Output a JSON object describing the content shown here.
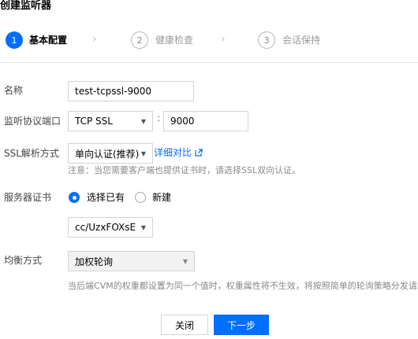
{
  "page": {
    "title": "创建监听器"
  },
  "steps": [
    {
      "number": "1",
      "label": "基本配置"
    },
    {
      "number": "2",
      "label": "健康检查"
    },
    {
      "number": "3",
      "label": "会话保持"
    }
  ],
  "form": {
    "name": {
      "label": "名称",
      "value": "test-tcpssl-9000"
    },
    "protocol_port": {
      "label": "监听协议端口",
      "protocol": "TCP SSL",
      "separator": ":",
      "port": "9000"
    },
    "ssl_mode": {
      "label": "SSL解析方式",
      "value": "单向认证(推荐)",
      "compare_link": "详细对比",
      "hint": "注意：当您需要客户端也提供证书时，请选择SSL双向认证。"
    },
    "server_cert": {
      "label": "服务器证书",
      "option_existing": "选择已有",
      "option_new": "新建",
      "selected_cert": "cc/UzxFOXsE"
    },
    "balance": {
      "label": "均衡方式",
      "value": "加权轮询",
      "hint": "当后端CVM的权重都设置为同一个值时，权重属性将不生效，将按照简单的轮询策略分发请求"
    }
  },
  "buttons": {
    "close": "关闭",
    "next": "下一步"
  },
  "colors": {
    "primary": "#006eff",
    "border": "#cfd5de",
    "hint": "#888888"
  }
}
